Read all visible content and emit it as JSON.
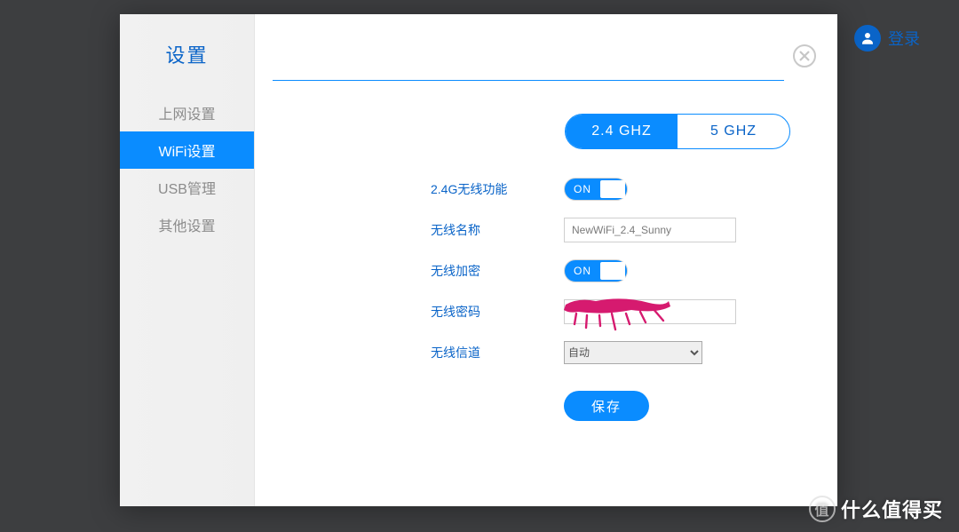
{
  "background": {
    "login_text": "登录"
  },
  "watermark": {
    "seal": "值",
    "text": "什么值得买"
  },
  "modal": {
    "sidebar": {
      "title": "设置",
      "items": [
        {
          "label": "上网设置",
          "active": false
        },
        {
          "label": "WiFi设置",
          "active": true
        },
        {
          "label": "USB管理",
          "active": false
        },
        {
          "label": "其他设置",
          "active": false
        }
      ]
    },
    "band_tabs": {
      "options": [
        "2.4 GHZ",
        "5 GHZ"
      ],
      "active_index": 0
    },
    "form": {
      "wifi_enable": {
        "label": "2.4G无线功能",
        "value": "ON"
      },
      "ssid": {
        "label": "无线名称",
        "value": "NewWiFi_2.4_Sunny"
      },
      "encrypt": {
        "label": "无线加密",
        "value": "ON"
      },
      "password": {
        "label": "无线密码"
      },
      "channel": {
        "label": "无线信道",
        "selected": "自动",
        "options": [
          "自动"
        ]
      },
      "save_label": "保存"
    }
  }
}
